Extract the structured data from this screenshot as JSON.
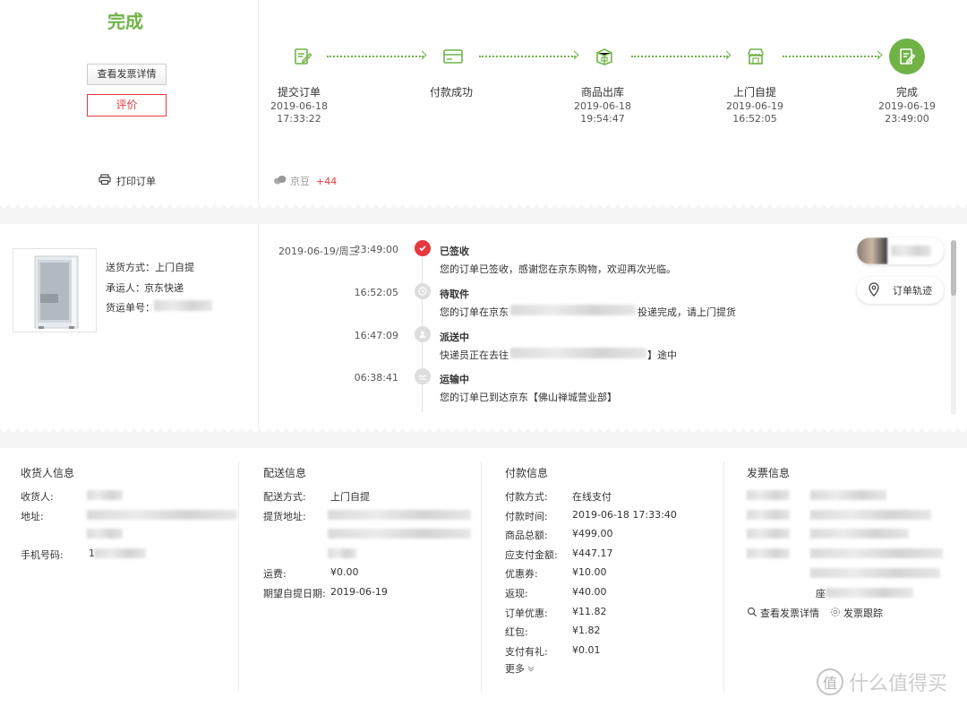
{
  "status": {
    "title": "完成",
    "invoice_button": "查看发票详情",
    "review_button": "评价",
    "print": "打印订单"
  },
  "progress": {
    "steps": [
      {
        "label": "提交订单",
        "date": "2019-06-18",
        "time": "17:33:22"
      },
      {
        "label": "付款成功",
        "date": "",
        "time": ""
      },
      {
        "label": "商品出库",
        "date": "2019-06-18",
        "time": "19:54:47"
      },
      {
        "label": "上门自提",
        "date": "2019-06-19",
        "time": "16:52:05"
      },
      {
        "label": "完成",
        "date": "2019-06-19",
        "time": "23:49:00"
      }
    ],
    "jingdou_label": "京豆",
    "jingdou_value": "+44"
  },
  "shipment": {
    "method_label": "送货方式：",
    "method_value": "上门自提",
    "carrier_label": "承运人：",
    "carrier_value": "京东快递",
    "tracking_label": "货运单号："
  },
  "tracking": {
    "date": "2019-06-19/周三",
    "events": [
      {
        "time": "23:49:00",
        "title": "已签收",
        "desc": "您的订单已签收，感谢您在京东购物，欢迎再次光临。"
      },
      {
        "time": "16:52:05",
        "title": "待取件",
        "desc_a": "您的订单在京东",
        "desc_b": "投递完成，请上门提货"
      },
      {
        "time": "16:47:09",
        "title": "派送中",
        "desc_a": "快递员正在去往",
        "desc_b": "】途中"
      },
      {
        "time": "06:38:41",
        "title": "运输中",
        "desc": "您的订单已到达京东【佛山禅城营业部】"
      }
    ],
    "track_button": "订单轨迹"
  },
  "receiver": {
    "heading": "收货人信息",
    "name_label": "收货人:",
    "address_label": "地址:",
    "phone_label": "手机号码:",
    "phone_prefix": "1"
  },
  "delivery": {
    "heading": "配送信息",
    "method_label": "配送方式:",
    "method_value": "上门自提",
    "address_label": "提货地址:",
    "fee_label": "运费:",
    "fee_value": "¥0.00",
    "date_label": "期望自提日期:",
    "date_value": "2019-06-19"
  },
  "payment": {
    "heading": "付款信息",
    "rows": [
      {
        "label": "付款方式:",
        "value": "在线支付"
      },
      {
        "label": "付款时间:",
        "value": "2019-06-18 17:33:40"
      },
      {
        "label": "商品总额:",
        "value": "¥499.00"
      },
      {
        "label": "应支付金额:",
        "value": "¥447.17"
      },
      {
        "label": "优惠券:",
        "value": "¥10.00"
      },
      {
        "label": "返现:",
        "value": "¥40.00"
      },
      {
        "label": "订单优惠:",
        "value": "¥11.82"
      },
      {
        "label": "红包:",
        "value": "¥1.82"
      },
      {
        "label": "支付有礼:",
        "value": "¥0.01"
      }
    ],
    "more": "更多"
  },
  "invoice": {
    "heading": "发票信息",
    "view_link": "查看发票详情",
    "track_link": "发票跟踪",
    "seat_char": "座"
  },
  "watermark": {
    "text": "什么值得买",
    "logo": "值"
  },
  "colors": {
    "green": "#71b247",
    "red": "#e4393c",
    "orange": "#e4393c"
  }
}
